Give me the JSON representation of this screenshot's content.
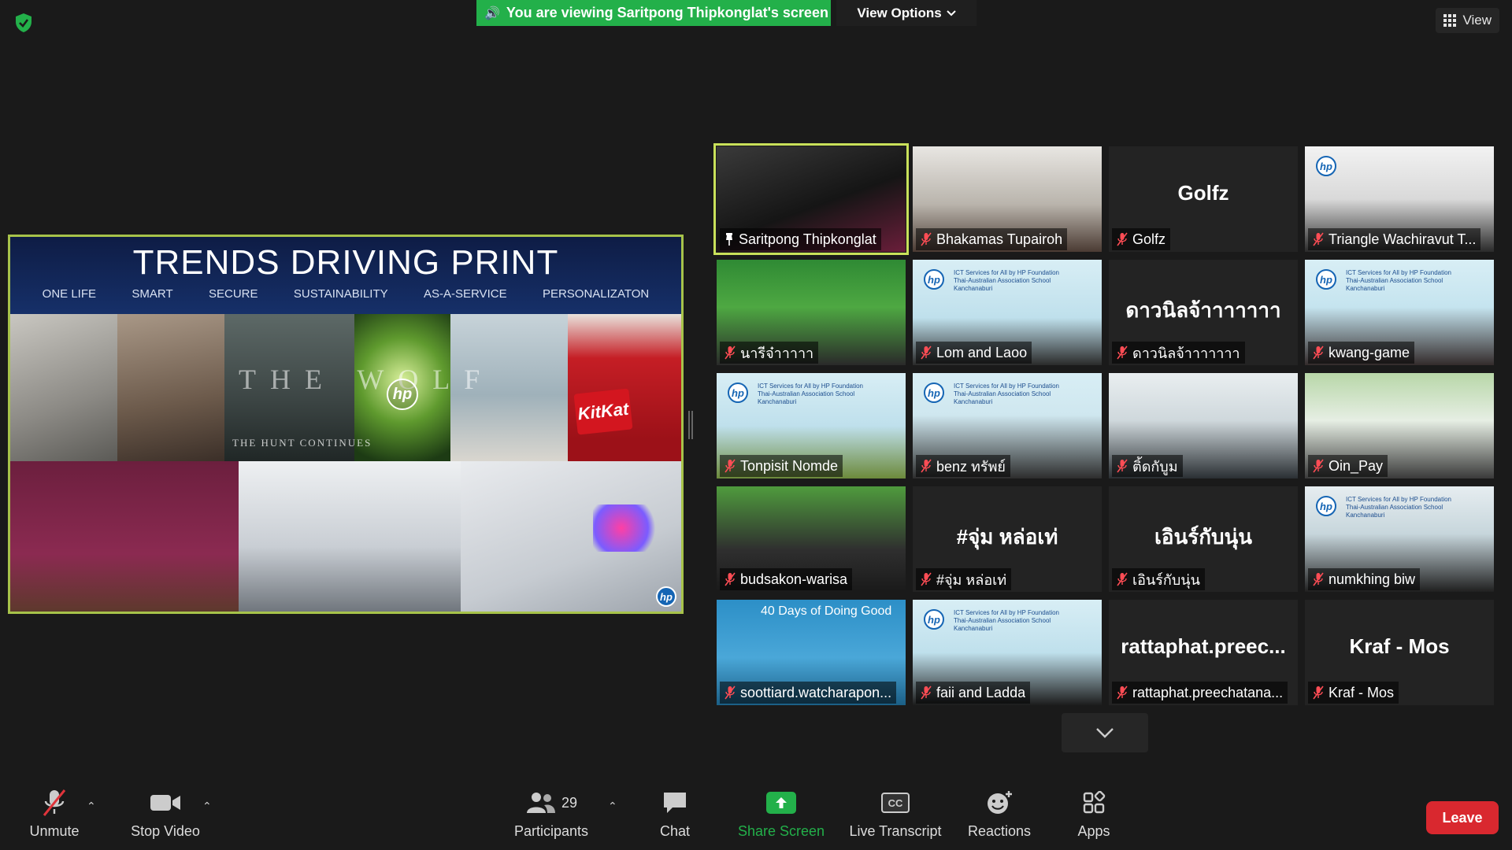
{
  "colors": {
    "share_green": "#23b04a",
    "active_speaker": "#c9e15a",
    "leave_red": "#d9282f",
    "background": "#1a1a1a"
  },
  "topbar": {
    "share_banner": "You are viewing Saritpong Thipkonglat's screen",
    "view_options": "View Options",
    "view_button": "View"
  },
  "shared_screen": {
    "slide_title": "TRENDS DRIVING PRINT",
    "trends": [
      "ONE LIFE",
      "SMART",
      "SECURE",
      "SUSTAINABILITY",
      "AS-A-SERVICE",
      "PERSONALIZATON"
    ],
    "wolf_title": "THE WOLF",
    "wolf_subtitle": "THE HUNT CONTINUES",
    "kitkat": "KitKat",
    "hp": "hp"
  },
  "participants": [
    {
      "name": "Saritpong Thipkonglat",
      "pinned": true,
      "muted": false,
      "video": true
    },
    {
      "name": "Bhakamas Tupairoh",
      "muted": true,
      "video": true
    },
    {
      "name": "Golfz",
      "muted": true,
      "video": false,
      "display": "Golfz"
    },
    {
      "name": "Triangle Wachiravut T...",
      "muted": true,
      "video": true
    },
    {
      "name": "นารีจ๋าาาาา",
      "muted": true,
      "video": true
    },
    {
      "name": "Lom and Laoo",
      "muted": true,
      "video": true
    },
    {
      "name": "ดาวนิลจ้าาาาาาา",
      "muted": true,
      "video": false,
      "display": "ดาวนิลจ้าาาาาาา"
    },
    {
      "name": "kwang-game",
      "muted": true,
      "video": true
    },
    {
      "name": "Tonpisit Nomde",
      "muted": true,
      "video": true
    },
    {
      "name": "benz ทรัพย์",
      "muted": true,
      "video": true
    },
    {
      "name": "ติ้ดกับูม",
      "muted": true,
      "video": true
    },
    {
      "name": "Oin_Pay",
      "muted": true,
      "video": true
    },
    {
      "name": "budsakon-warisa",
      "muted": true,
      "video": true
    },
    {
      "name": "#จุ่ม หล่อเท่",
      "muted": true,
      "video": false,
      "display": "#จุ่ม หล่อเท่"
    },
    {
      "name": "เอินร์กับนุ่น",
      "muted": true,
      "video": false,
      "display": "เอินร์กับนุ่น"
    },
    {
      "name": "numkhing biw",
      "muted": true,
      "video": true
    },
    {
      "name": "soottiard.watcharapon...",
      "muted": true,
      "video": true
    },
    {
      "name": "faii and Ladda",
      "muted": true,
      "video": true
    },
    {
      "name": "rattaphat.preechatana...",
      "muted": true,
      "video": false,
      "display": "rattaphat.preec..."
    },
    {
      "name": "Kraf - Mos",
      "muted": true,
      "video": false,
      "display": "Kraf - Mos"
    }
  ],
  "tile_extras": {
    "days_banner": "40 Days of Doing Good",
    "ict_banner": "ICT Services for All by HP Foundation Thai-Australian Association School Kanchanaburi"
  },
  "toolbar": {
    "unmute": "Unmute",
    "stop_video": "Stop Video",
    "participants": "Participants",
    "participants_count": "29",
    "chat": "Chat",
    "share_screen": "Share Screen",
    "live_transcript": "Live Transcript",
    "reactions": "Reactions",
    "apps": "Apps",
    "leave": "Leave",
    "cc": "CC"
  }
}
